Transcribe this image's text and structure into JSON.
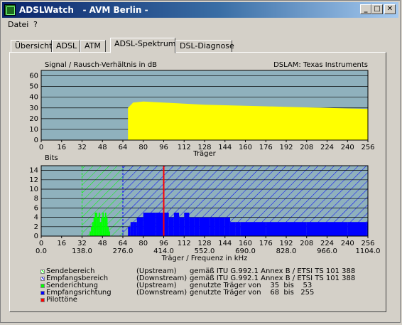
{
  "window": {
    "title": "ADSLWatch   - AVM Berlin -",
    "controls": {
      "minimize": "_",
      "maximize": "□",
      "close": "✕"
    }
  },
  "menu": {
    "items": [
      "Datei",
      "?"
    ]
  },
  "tabs": [
    "Übersicht",
    "ADSL",
    "ATM",
    "ADSL-Spektrum",
    "DSL-Diagnose"
  ],
  "active_tab": "ADSL-Spektrum",
  "colors": {
    "plot_bg": "#8fb1bd",
    "snr_fill": "#ffff00",
    "upstream": "#00ff00",
    "downstream": "#0000ff",
    "pilot": "#ff0000",
    "send_hatch": "#00ff00",
    "recv_hatch": "#0000ff"
  },
  "chart_data": [
    {
      "type": "area",
      "title": "Signal / Rausch-Verhältnis in dB",
      "annotation": "DSLAM: Texas Instruments",
      "xlabel": "Träger",
      "ylabel": "",
      "xlim": [
        0,
        256
      ],
      "ylim": [
        0,
        65
      ],
      "xticks": [
        0,
        16,
        32,
        48,
        64,
        80,
        96,
        112,
        128,
        144,
        160,
        176,
        192,
        208,
        224,
        240,
        256
      ],
      "yticks": [
        0,
        10,
        20,
        30,
        40,
        50,
        60
      ],
      "grid": true,
      "x": [
        68,
        72,
        80,
        96,
        112,
        128,
        144,
        160,
        176,
        192,
        208,
        224,
        240,
        256
      ],
      "values": [
        30,
        35,
        36,
        35,
        34,
        33,
        32.5,
        32,
        31.5,
        31,
        30.5,
        30,
        29.5,
        29
      ]
    },
    {
      "type": "bar",
      "title": "Bits",
      "xlabel": "Träger / Frequenz in kHz",
      "xlim": [
        0,
        256
      ],
      "ylim": [
        0,
        15
      ],
      "xticks": [
        0,
        16,
        32,
        48,
        64,
        80,
        96,
        112,
        128,
        144,
        160,
        176,
        192,
        208,
        224,
        240,
        256
      ],
      "xticks_khz": [
        "0.0",
        "138.0",
        "276.0",
        "414.0",
        "552.0",
        "690.0",
        "828.0",
        "966.0",
        "1104.0"
      ],
      "yticks": [
        0,
        2,
        4,
        6,
        8,
        10,
        12,
        14
      ],
      "grid": true,
      "send_range": [
        32,
        64
      ],
      "recv_range": [
        64,
        256
      ],
      "pilot_tone": 96,
      "series": [
        {
          "name": "Senderichtung",
          "x": [
            38,
            39,
            40,
            41,
            42,
            43,
            44,
            45,
            46,
            47,
            48,
            49,
            50,
            51,
            52,
            53
          ],
          "values": [
            1,
            2,
            3,
            4,
            5,
            5,
            4,
            5,
            3,
            4,
            5,
            4,
            5,
            4,
            2,
            1
          ]
        },
        {
          "name": "Empfangsrichtung",
          "x": [
            68,
            70,
            72,
            75,
            76,
            80,
            90,
            96,
            100,
            104,
            108,
            112,
            116,
            120,
            124,
            128,
            132,
            136,
            140,
            144,
            148,
            152,
            156,
            160,
            176,
            192,
            208,
            224,
            240,
            255
          ],
          "values": [
            2,
            3,
            3,
            4,
            4,
            5,
            5,
            5,
            4,
            5,
            4,
            5,
            4,
            4,
            4,
            4,
            4,
            4,
            4,
            4,
            3,
            3,
            3,
            3,
            3,
            3,
            3,
            3,
            3,
            3
          ]
        }
      ]
    }
  ],
  "legend": [
    {
      "swatch": "send_hatch",
      "label": "Sendebereich",
      "dir": "(Upstream)",
      "desc": "gemäß ITU G.992.1 Annex B / ETSI TS 101 388"
    },
    {
      "swatch": "recv_hatch",
      "label": "Empfangsbereich",
      "dir": "(Downstream)",
      "desc": "gemäß ITU G.992.1 Annex B / ETSI TS 101 388"
    },
    {
      "swatch": "upstream",
      "label": "Senderichtung",
      "dir": "(Upstream)",
      "desc": "genutzte Träger von    35  bis    53"
    },
    {
      "swatch": "downstream",
      "label": "Empfangsrichtung",
      "dir": "(Downstream)",
      "desc": "genutzte Träger von    68  bis   255"
    },
    {
      "swatch": "pilot",
      "label": "Pilottöne",
      "dir": "",
      "desc": ""
    }
  ]
}
